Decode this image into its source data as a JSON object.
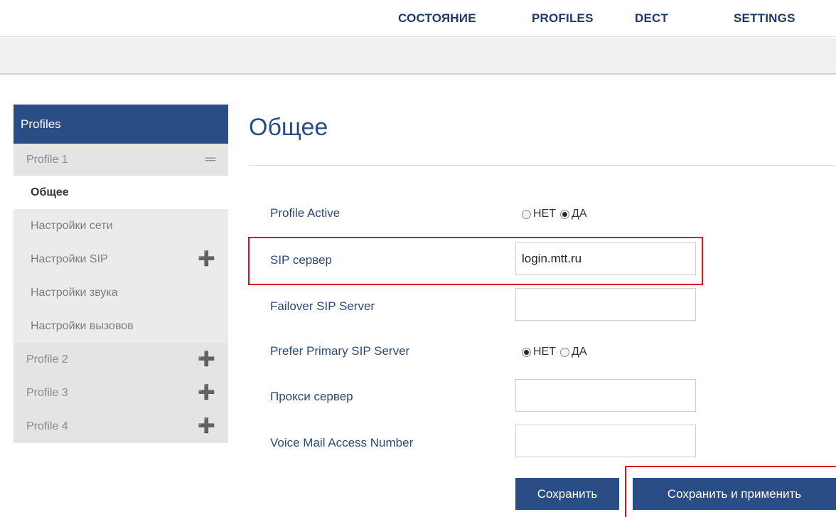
{
  "topnav": {
    "items": [
      "СОСТОЯНИЕ",
      "PROFILES",
      "DECT",
      "SETTINGS"
    ]
  },
  "sidebar": {
    "header": "Profiles",
    "profile1": {
      "label": "Profile 1",
      "icon": "minus-icon"
    },
    "sub_items": [
      "Общее",
      "Настройки сети",
      "Настройки SIP",
      "Настройки звука",
      "Настройки вызовов"
    ],
    "profiles": [
      "Profile 2",
      "Profile 3",
      "Profile 4"
    ]
  },
  "main": {
    "title": "Общее",
    "fields": {
      "profile_active": {
        "label": "Profile Active",
        "options": [
          "НЕТ",
          "ДА"
        ],
        "selected": "ДА"
      },
      "sip_server": {
        "label": "SIP сервер",
        "value": "login.mtt.ru"
      },
      "failover_sip": {
        "label": "Failover SIP Server",
        "value": ""
      },
      "prefer_primary": {
        "label": "Prefer Primary SIP Server",
        "options": [
          "НЕТ",
          "ДА"
        ],
        "selected": "НЕТ"
      },
      "proxy_server": {
        "label": "Прокси сервер",
        "value": ""
      },
      "voicemail": {
        "label": "Voice Mail Access Number",
        "value": ""
      }
    },
    "buttons": {
      "save": "Сохранить",
      "save_apply": "Сохранить и применить"
    }
  },
  "colors": {
    "primary": "#2b4d86",
    "highlight": "#d9141e"
  }
}
